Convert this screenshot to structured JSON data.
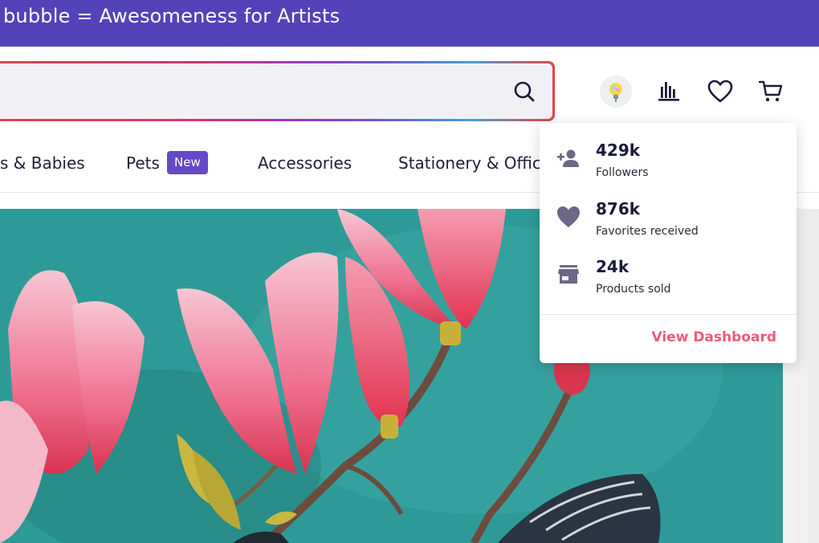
{
  "banner": {
    "text": "bubble = Awesomeness for Artists"
  },
  "search": {
    "value": "",
    "placeholder": ""
  },
  "header": {
    "icons": [
      "lightbulb-avatar",
      "bar-chart-icon",
      "heart-icon",
      "cart-icon"
    ]
  },
  "nav": {
    "items": [
      {
        "label": "s & Babies"
      },
      {
        "label": "Pets",
        "badge": "New"
      },
      {
        "label": "Accessories"
      },
      {
        "label": "Stationery & Office"
      }
    ]
  },
  "dropdown": {
    "stats": [
      {
        "value": "429k",
        "label": "Followers",
        "icon": "add-person-icon"
      },
      {
        "value": "876k",
        "label": "Favorites received",
        "icon": "heart-icon"
      },
      {
        "value": "24k",
        "label": "Products sold",
        "icon": "store-icon"
      }
    ],
    "link": "View Dashboard"
  },
  "colors": {
    "banner": "#5443b8",
    "badge": "#6448c8",
    "link": "#ef5a76",
    "stat_icon": "#6e6788"
  }
}
